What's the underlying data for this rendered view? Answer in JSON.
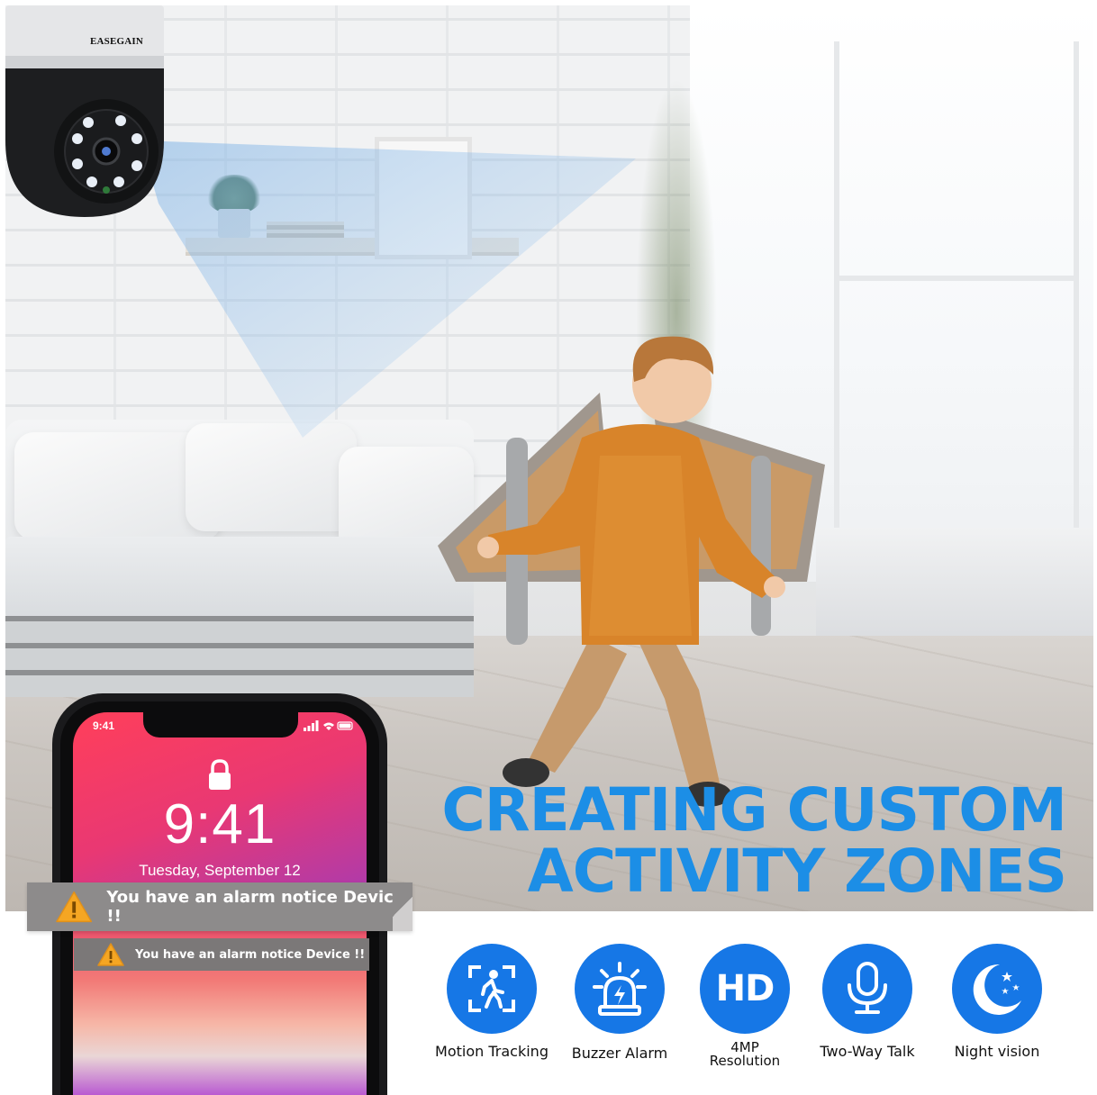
{
  "camera": {
    "brand": "EASEGAIN"
  },
  "headline": {
    "line1": "CREATING CUSTOM",
    "line2": "ACTIVITY ZONES",
    "color": "#1c8ee6"
  },
  "phone": {
    "status_time": "9:41",
    "lock_time": "9:41",
    "lock_date": "Tuesday, September 12"
  },
  "notices": {
    "large": "You have an alarm notice Device !!",
    "small": "You have an alarm notice Device !!"
  },
  "features": [
    {
      "icon": "motion-tracking-icon",
      "label": "Motion Tracking"
    },
    {
      "icon": "buzzer-alarm-icon",
      "label": "Buzzer Alarm"
    },
    {
      "icon": "hd-icon",
      "icon_text": "HD",
      "label_line1": "4MP",
      "label_line2": "Resolution"
    },
    {
      "icon": "microphone-icon",
      "label": "Two-Way Talk"
    },
    {
      "icon": "moon-stars-icon",
      "label": "Night vision"
    }
  ],
  "colors": {
    "accent": "#1677e6",
    "headline": "#1c8ee6",
    "notice_bg": "#8d8b8b",
    "warning": "#f5a623"
  }
}
